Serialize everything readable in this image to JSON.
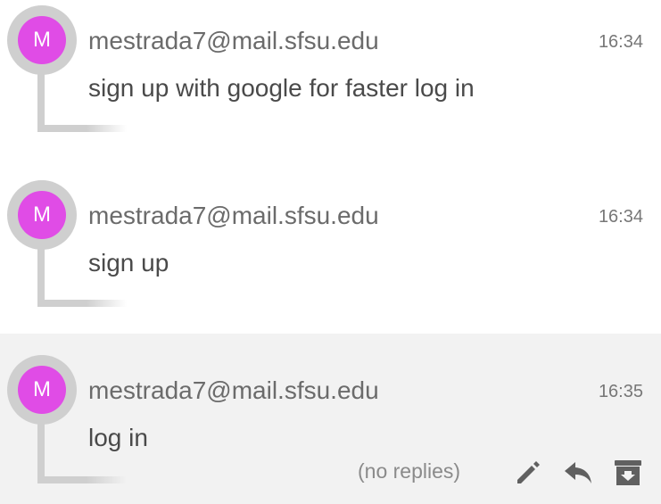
{
  "messages": [
    {
      "avatar_letter": "M",
      "sender": "mestrada7@mail.sfsu.edu",
      "time": "16:34",
      "body": "sign up with google for faster log in"
    },
    {
      "avatar_letter": "M",
      "sender": "mestrada7@mail.sfsu.edu",
      "time": "16:34",
      "body": "sign up"
    },
    {
      "avatar_letter": "M",
      "sender": "mestrada7@mail.sfsu.edu",
      "time": "16:35",
      "body": "log in",
      "replies_text": "(no replies)"
    }
  ],
  "icons": {
    "edit": "pencil-icon",
    "reply": "reply-arrow-icon",
    "archive": "archive-box-icon"
  },
  "colors": {
    "avatar": "#e04ce6",
    "avatar_ring": "#cfcfcf",
    "highlight_row": "#f2f2f2",
    "icon": "#606060"
  }
}
